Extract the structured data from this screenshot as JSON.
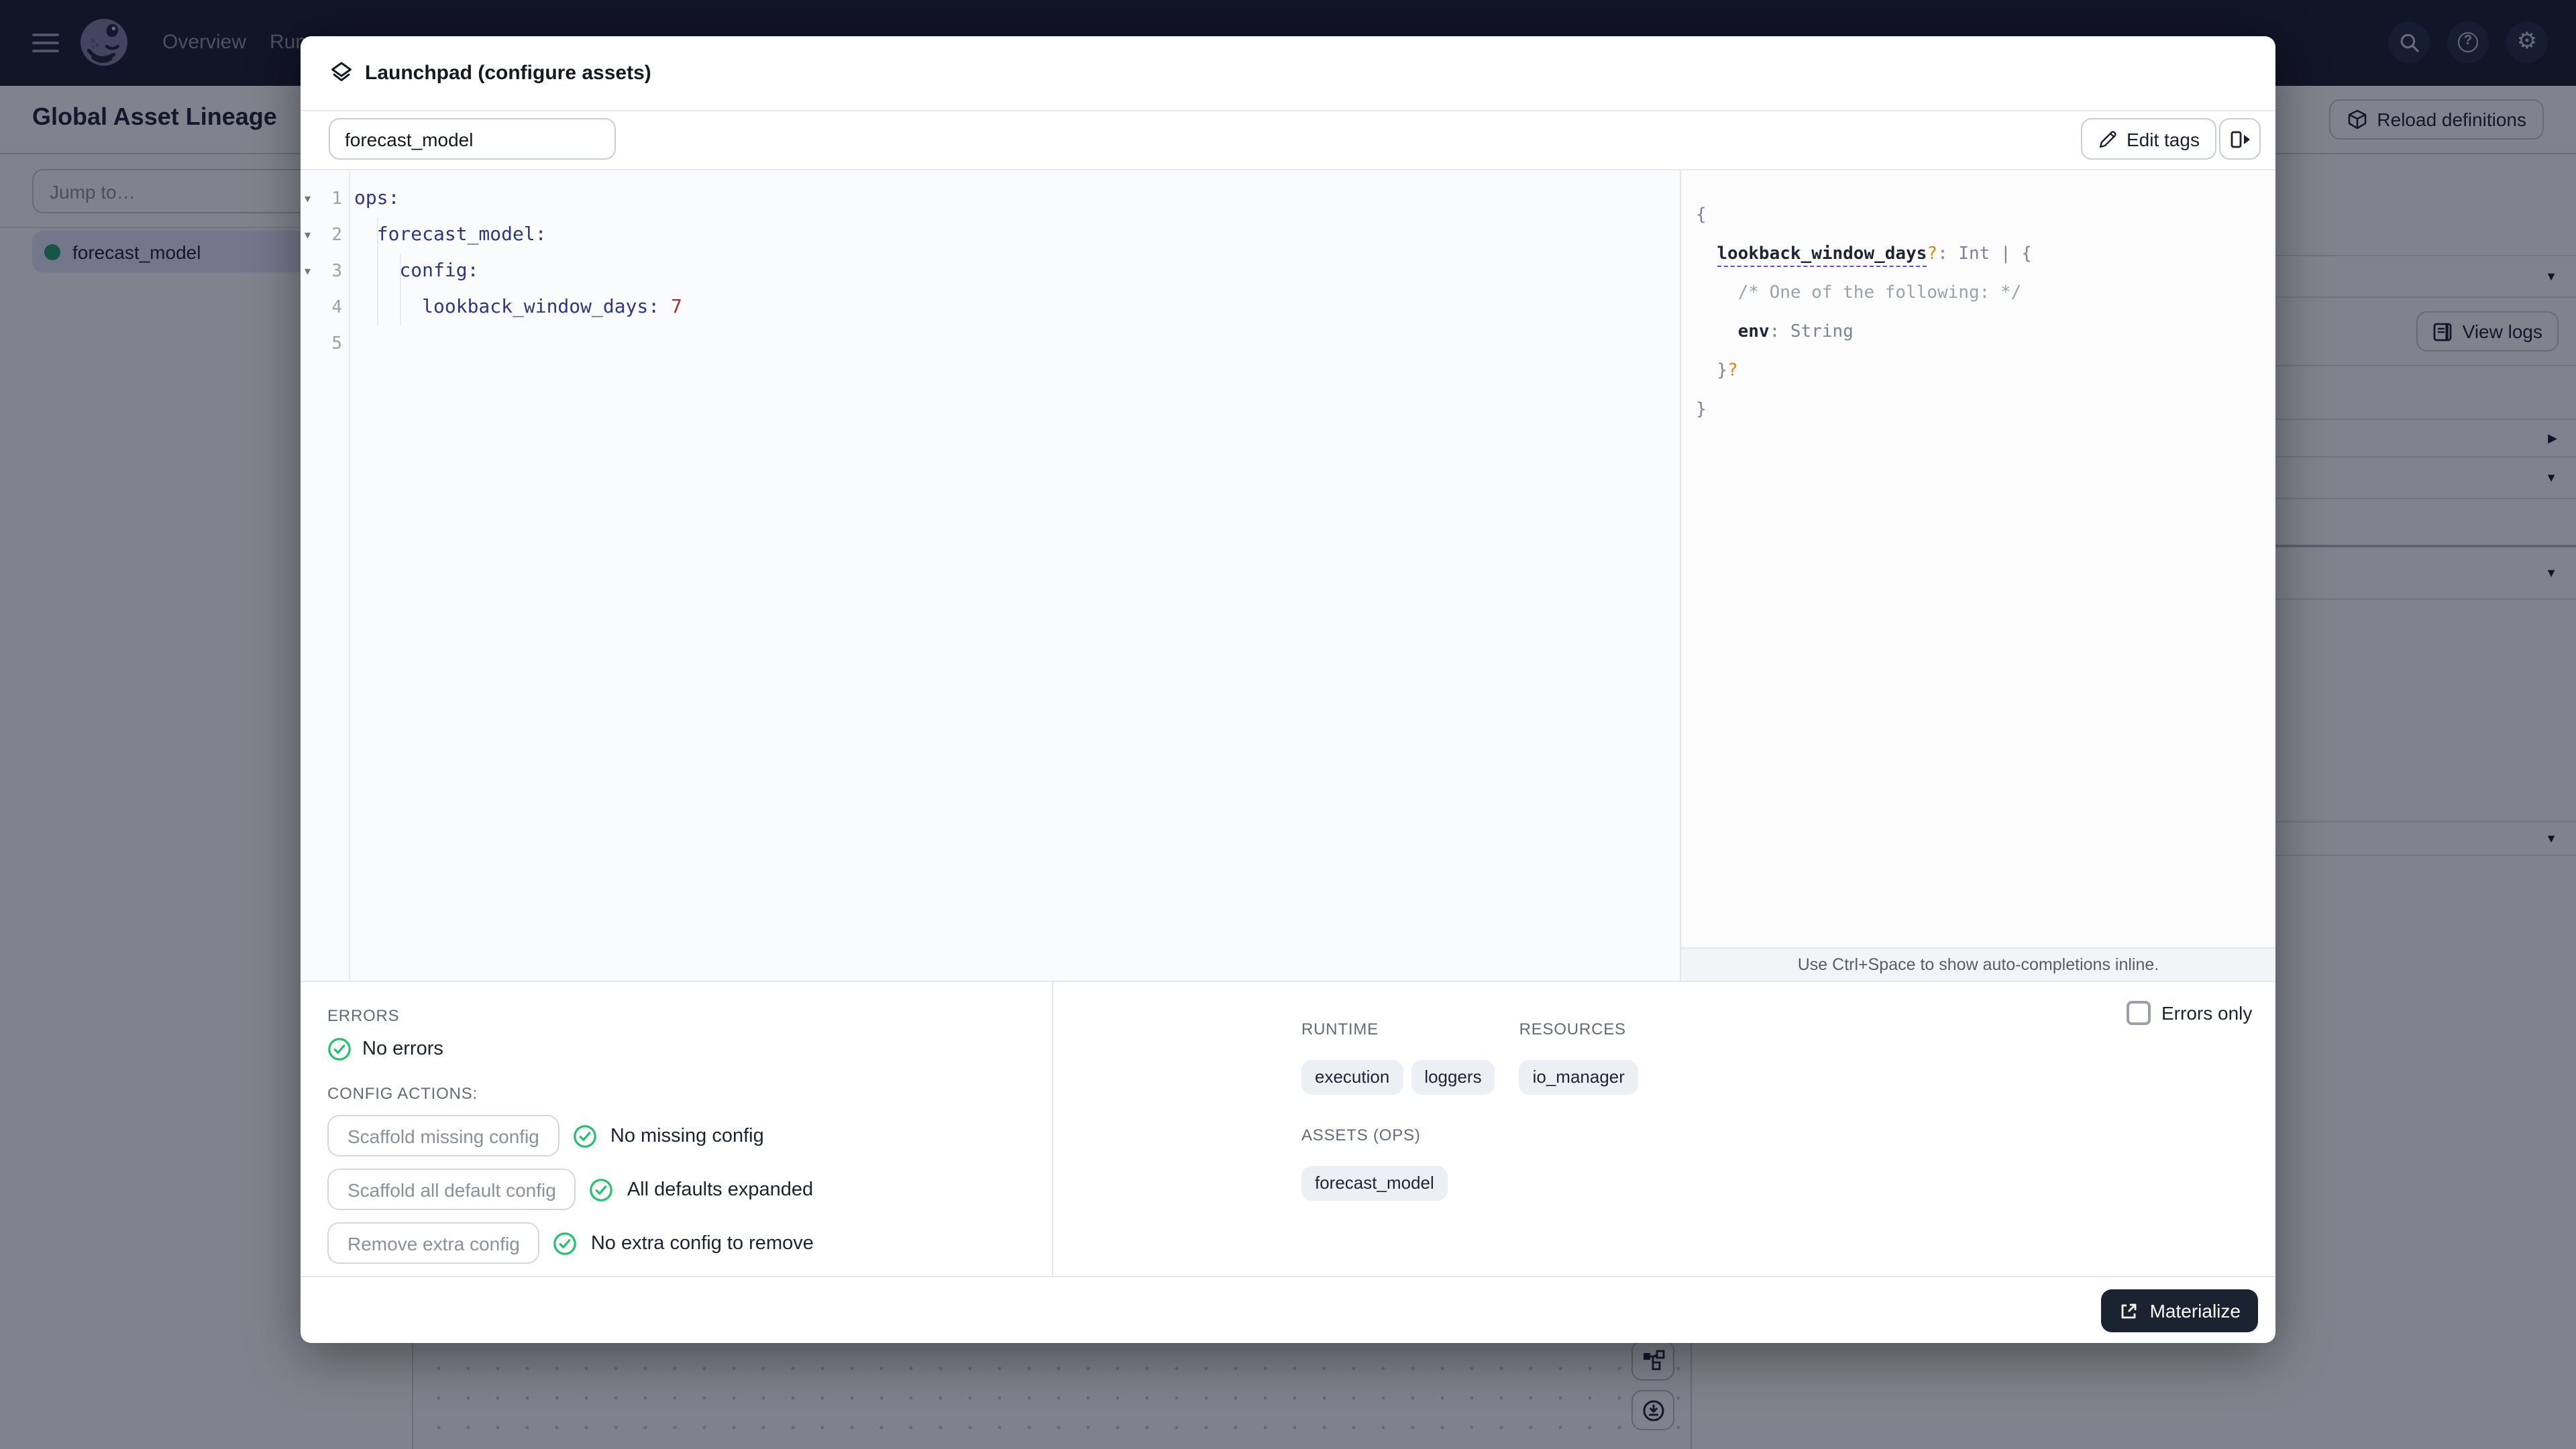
{
  "nav": {
    "items": [
      {
        "label": "Overview"
      },
      {
        "label": "Runs"
      }
    ],
    "icons": [
      "menu-icon",
      "dagster-logo",
      "search-icon",
      "help-icon",
      "settings-icon"
    ]
  },
  "page": {
    "title": "Global Asset Lineage",
    "reload_button": "Reload definitions",
    "sidebar": {
      "jump_placeholder": "Jump to…",
      "asset": "forecast_model"
    },
    "right_panel": {
      "view_logs": "View logs",
      "rows": [
        {
          "h": 76
        },
        {
          "h": 31,
          "chev": "down"
        },
        {
          "h": 51,
          "button": "view-logs"
        },
        {
          "h": 40
        },
        {
          "h": 28,
          "chev": "right"
        },
        {
          "h": 31,
          "chev": "down"
        },
        {
          "h": 36,
          "thick": true
        },
        {
          "h": 39,
          "chev": "down"
        },
        {
          "h": 166
        },
        {
          "h": 25,
          "chev": "down"
        }
      ]
    }
  },
  "modal": {
    "title": "Launchpad (configure assets)",
    "session_name": "forecast_model",
    "edit_tags": "Edit tags",
    "editor": {
      "lines": [
        {
          "num": "1",
          "fold": true,
          "segs": [
            {
              "c": "k",
              "t": "ops:"
            }
          ]
        },
        {
          "num": "2",
          "fold": true,
          "segs": [
            {
              "c": "k",
              "t": "  forecast_model:"
            }
          ]
        },
        {
          "num": "3",
          "fold": true,
          "segs": [
            {
              "c": "k",
              "t": "    config:"
            }
          ]
        },
        {
          "num": "4",
          "fold": false,
          "segs": [
            {
              "c": "k",
              "t": "      lookback_window_days:"
            },
            {
              "c": "n",
              "t": " 7"
            }
          ]
        },
        {
          "num": "5",
          "fold": false,
          "segs": []
        }
      ]
    },
    "schema": {
      "lines": [
        {
          "segs": [
            {
              "c": "p",
              "t": "{"
            }
          ]
        },
        {
          "segs": [
            {
              "c": "p",
              "t": "  "
            },
            {
              "c": "ku",
              "t": "lookback_window_days"
            },
            {
              "c": "o",
              "t": "?"
            },
            {
              "c": "p",
              "t": ": Int | {"
            }
          ]
        },
        {
          "segs": [
            {
              "c": "c",
              "t": "    /* One of the following: */"
            }
          ]
        },
        {
          "segs": [
            {
              "c": "p",
              "t": "    "
            },
            {
              "c": "kb",
              "t": "env"
            },
            {
              "c": "p",
              "t": ": String"
            }
          ]
        },
        {
          "segs": [
            {
              "c": "p",
              "t": "  }"
            },
            {
              "c": "o",
              "t": "?"
            }
          ]
        },
        {
          "segs": [
            {
              "c": "p",
              "t": "}"
            }
          ]
        }
      ],
      "hint": "Use Ctrl+Space to show auto-completions inline."
    },
    "errors": {
      "label": "ERRORS",
      "status": "No errors"
    },
    "config_actions": {
      "label": "CONFIG ACTIONS:",
      "actions": [
        {
          "button": "Scaffold missing config",
          "status": "No missing config"
        },
        {
          "button": "Scaffold all default config",
          "status": "All defaults expanded"
        },
        {
          "button": "Remove extra config",
          "status": "No extra config to remove"
        }
      ]
    },
    "errors_only_label": "Errors only",
    "runtime": {
      "label": "RUNTIME",
      "tags": [
        "execution",
        "loggers"
      ]
    },
    "resources": {
      "label": "RESOURCES",
      "tags": [
        "io_manager"
      ]
    },
    "assets_ops": {
      "label": "ASSETS (OPS)",
      "tags": [
        "forecast_model"
      ]
    },
    "materialize": "Materialize"
  },
  "colors": {
    "accent_green": "#23c06d",
    "materialize_bg": "#1b2330",
    "yaml_key": "#2d3784",
    "yaml_number": "#a5322a",
    "optional_marker": "#d9861c",
    "selected_asset_bg": "#e7e3fb"
  }
}
